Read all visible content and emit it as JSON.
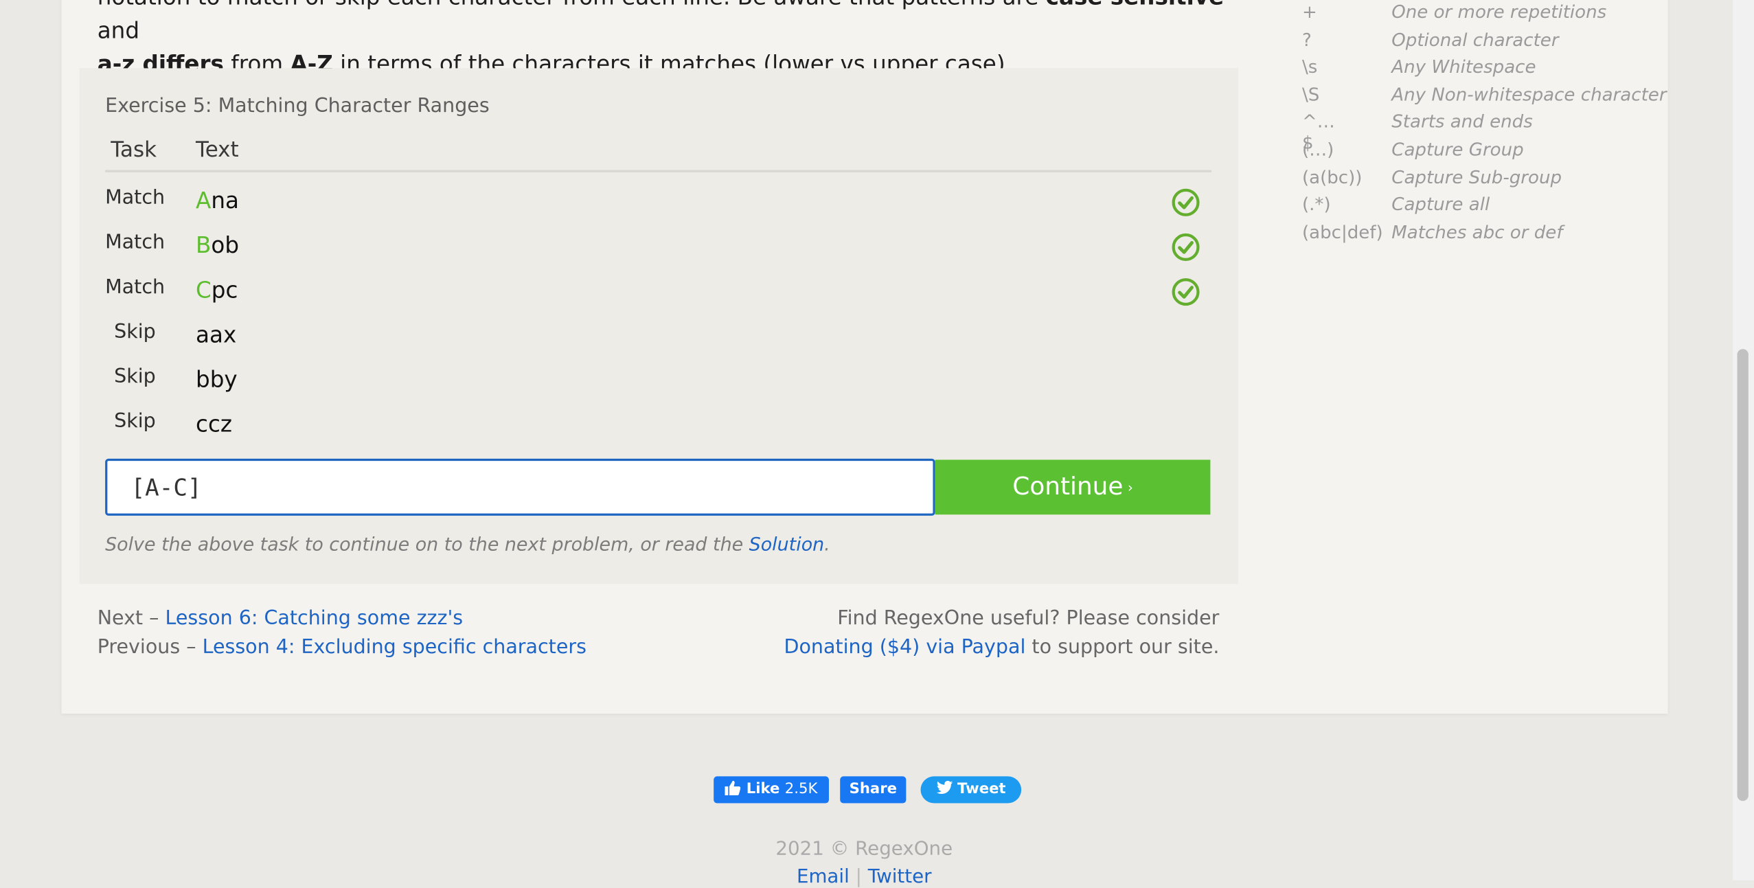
{
  "intro": {
    "line1_a": "notation to match or skip each character from each line. Be aware that patterns are ",
    "line1_b": "case sensitive",
    "line1_c": " and",
    "line2_a": "a-z differs",
    "line2_b": " from ",
    "line2_c": "A-Z",
    "line2_d": " in terms of the characters it matches (lower vs upper case)."
  },
  "exercise": {
    "title": "Exercise 5: Matching Character Ranges",
    "col_task": "Task",
    "col_text": "Text",
    "rows": [
      {
        "task": "Match",
        "highlight": "A",
        "rest": "na",
        "checked": true
      },
      {
        "task": "Match",
        "highlight": "B",
        "rest": "ob",
        "checked": true
      },
      {
        "task": "Match",
        "highlight": "C",
        "rest": "pc",
        "checked": true
      },
      {
        "task": "Skip",
        "highlight": "",
        "rest": "aax",
        "checked": false
      },
      {
        "task": "Skip",
        "highlight": "",
        "rest": "bby",
        "checked": false
      },
      {
        "task": "Skip",
        "highlight": "",
        "rest": "ccz",
        "checked": false
      }
    ],
    "input_value": "[A-C]",
    "continue_label": "Continue",
    "continue_arrow": "›",
    "hint_text": "Solve the above task to continue on to the next problem, or read the ",
    "hint_link": "Solution",
    "hint_end": "."
  },
  "nav": {
    "next_prefix": "Next – ",
    "next_link": "Lesson 6: Catching some zzz's",
    "prev_prefix": "Previous – ",
    "prev_link": "Lesson 4: Excluding specific characters",
    "donate_line1": "Find RegexOne useful? Please consider",
    "donate_link": "Donating ($4) via Paypal",
    "donate_suffix": " to support our site."
  },
  "reference": [
    {
      "k": "+",
      "v": "One or more repetitions"
    },
    {
      "k": "?",
      "v": "Optional character"
    },
    {
      "k": "\\s",
      "v": "Any Whitespace"
    },
    {
      "k": "\\S",
      "v": "Any Non-whitespace character"
    },
    {
      "k": "^…$",
      "v": "Starts and ends"
    },
    {
      "k": "(…)",
      "v": "Capture Group"
    },
    {
      "k": "(a(bc))",
      "v": "Capture Sub-group"
    },
    {
      "k": "(.*)",
      "v": "Capture all"
    },
    {
      "k": "(abc|def)",
      "v": "Matches abc or def"
    }
  ],
  "social": {
    "like_label": "Like",
    "like_count": "2.5K",
    "share_label": "Share",
    "tweet_label": "Tweet"
  },
  "footer": {
    "copyright": "2021 © RegexOne",
    "email": "Email",
    "sep": "|",
    "twitter": "Twitter"
  },
  "colors": {
    "accent_green": "#5bc132",
    "link_blue": "#1d64c4",
    "input_border": "#1f66c1"
  }
}
